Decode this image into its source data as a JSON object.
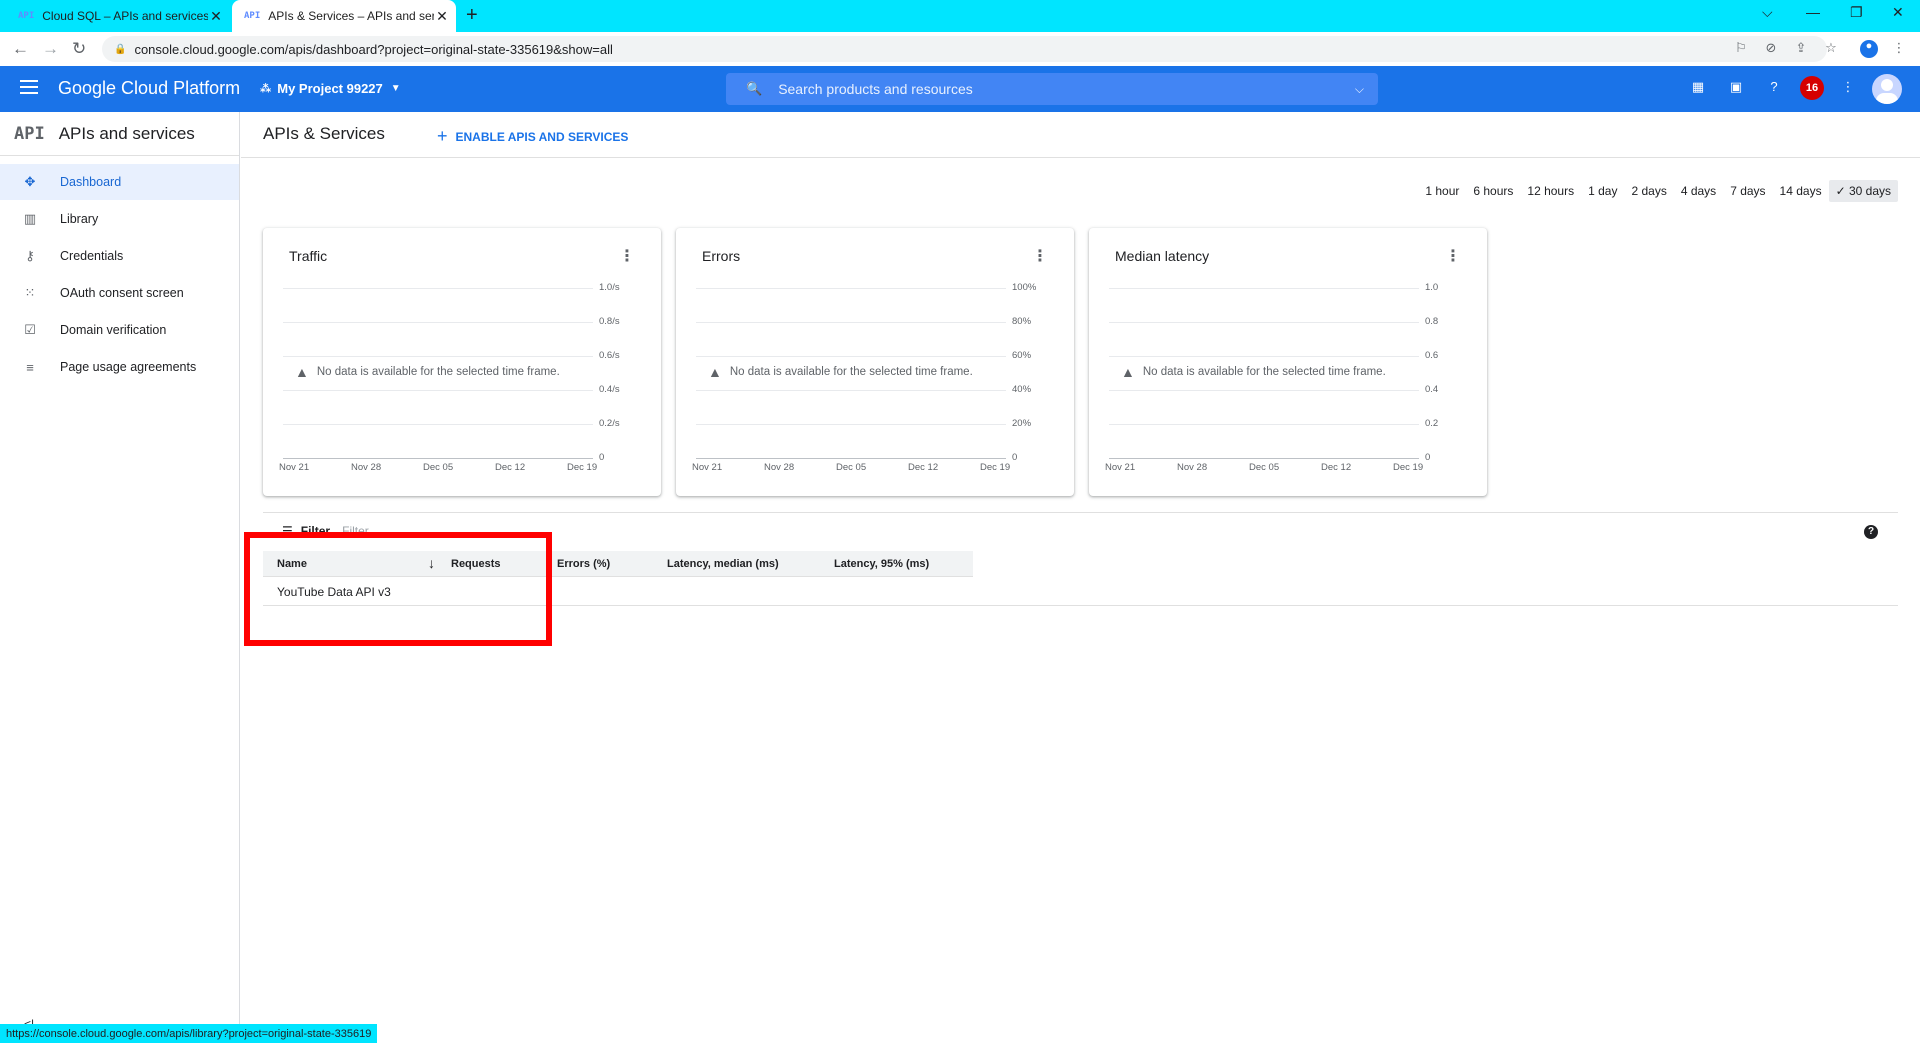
{
  "browser": {
    "tabs": [
      {
        "favicon": "API",
        "title": "Cloud SQL – APIs and services – "
      },
      {
        "favicon": "API",
        "title": "APIs & Services – APIs and servic"
      }
    ],
    "url": "console.cloud.google.com/apis/dashboard?project=original-state-335619&show=all"
  },
  "header": {
    "brand": "Google Cloud Platform",
    "project": "My Project 99227",
    "search_placeholder": "Search products and resources",
    "notification_count": "16"
  },
  "sidenav": {
    "logo": "API",
    "title": "APIs and services",
    "items": [
      {
        "label": "Dashboard",
        "icon": "dashboard-icon"
      },
      {
        "label": "Library",
        "icon": "library-icon"
      },
      {
        "label": "Credentials",
        "icon": "key-icon"
      },
      {
        "label": "OAuth consent screen",
        "icon": "consent-icon"
      },
      {
        "label": "Domain verification",
        "icon": "checkbox-icon"
      },
      {
        "label": "Page usage agreements",
        "icon": "settings-list-icon"
      }
    ],
    "collapse": "<|"
  },
  "main": {
    "title": "APIs & Services",
    "enable_button": "ENABLE APIS AND SERVICES",
    "time_ranges": [
      "1 hour",
      "6 hours",
      "12 hours",
      "1 day",
      "2 days",
      "4 days",
      "7 days",
      "14 days",
      "30 days"
    ],
    "selected_range": "30 days"
  },
  "charts": [
    {
      "title": "Traffic",
      "yticks": [
        "1.0/s",
        "0.8/s",
        "0.6/s",
        "0.4/s",
        "0.2/s",
        "0"
      ]
    },
    {
      "title": "Errors",
      "yticks": [
        "100%",
        "80%",
        "60%",
        "40%",
        "20%",
        "0"
      ]
    },
    {
      "title": "Median latency",
      "yticks": [
        "1.0",
        "0.8",
        "0.6",
        "0.4",
        "0.2",
        "0"
      ]
    }
  ],
  "chart_xticks": [
    "Nov 21",
    "Nov 28",
    "Dec 05",
    "Dec 12",
    "Dec 19"
  ],
  "no_data_message": "No data is available for the selected time frame.",
  "chart_data": [
    {
      "type": "line",
      "title": "Traffic",
      "x": [
        "Nov 21",
        "Nov 28",
        "Dec 05",
        "Dec 12",
        "Dec 19"
      ],
      "series": [],
      "ylim": [
        0,
        1.0
      ],
      "ylabel": "",
      "grid": true
    },
    {
      "type": "line",
      "title": "Errors",
      "x": [
        "Nov 21",
        "Nov 28",
        "Dec 05",
        "Dec 12",
        "Dec 19"
      ],
      "series": [],
      "ylim": [
        0,
        100
      ],
      "ylabel": "",
      "grid": true
    },
    {
      "type": "line",
      "title": "Median latency",
      "x": [
        "Nov 21",
        "Nov 28",
        "Dec 05",
        "Dec 12",
        "Dec 19"
      ],
      "series": [],
      "ylim": [
        0,
        1.0
      ],
      "ylabel": "",
      "grid": true
    }
  ],
  "table": {
    "filter_label": "Filter",
    "filter_placeholder": "Filter",
    "columns": [
      "Name",
      "Requests",
      "Errors (%)",
      "Latency, median (ms)",
      "Latency, 95% (ms)"
    ],
    "rows": [
      {
        "name": "YouTube Data API v3"
      }
    ]
  },
  "status_url": "https://console.cloud.google.com/apis/library?project=original-state-335619",
  "highlight_color": "#ff0000"
}
